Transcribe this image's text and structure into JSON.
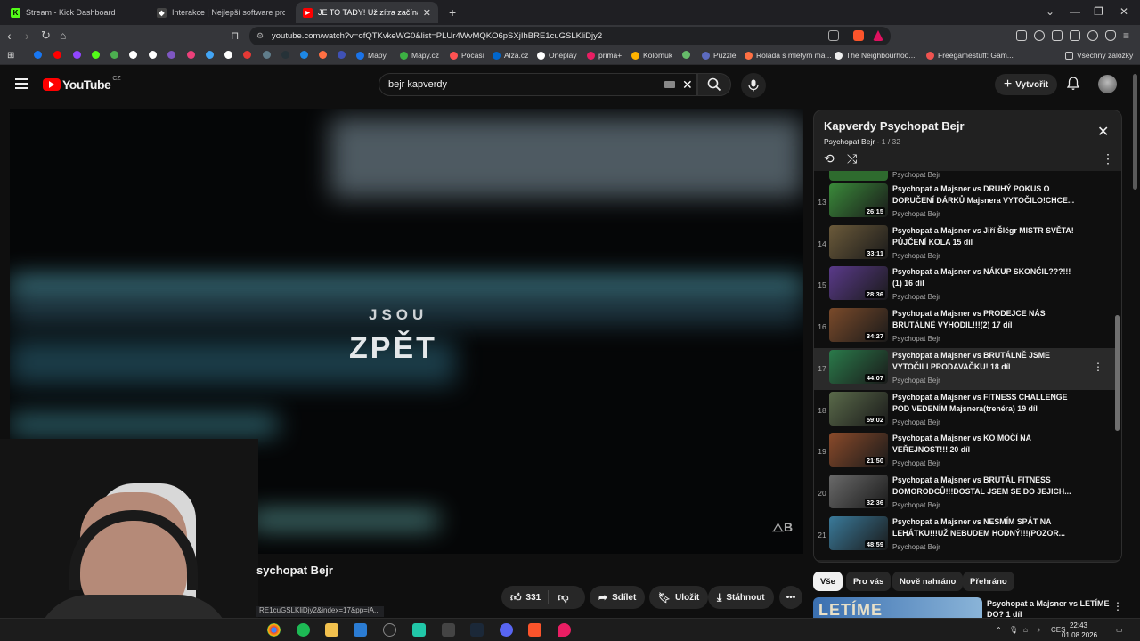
{
  "browser": {
    "tabs": [
      {
        "title": "Stream - Kick Dashboard",
        "favicon_color": "#53fc18",
        "favicon_text": "K"
      },
      {
        "title": "Interakce | Nejlepší software pro vyle",
        "favicon_color": "#cccccc",
        "favicon_text": ""
      },
      {
        "title": "JE TO TADY! Už zítra začíná show",
        "favicon_color": "#ff0000",
        "favicon_text": ""
      }
    ],
    "url": "youtube.com/watch?v=ofQTKvkeWG0&list=PLUr4WvMQKO6pSXjIhBRE1cuGSLKliDjy2",
    "bookmarks": [
      {
        "label": "Mapy",
        "color": "#1a73e8"
      },
      {
        "label": "Mapy.cz",
        "color": "#3cb043"
      },
      {
        "label": "Počasí",
        "color": "#ff5252"
      },
      {
        "label": "Alza.cz",
        "color": "#0066cc"
      },
      {
        "label": "Oneplay",
        "color": "#ffffff"
      },
      {
        "label": "prima+",
        "color": "#e91e63"
      },
      {
        "label": "Kolomuk",
        "color": "#ffb300"
      },
      {
        "label": "Puzzle",
        "color": "#5c6bc0"
      },
      {
        "label": "Roláda s mletým ma...",
        "color": "#ff7043"
      },
      {
        "label": "The Neighbourhoo...",
        "color": "#eeeeee"
      },
      {
        "label": "Freegamestuff: Gam...",
        "color": "#ef5350"
      }
    ],
    "bookmarks_all": "Všechny záložky"
  },
  "youtube": {
    "logo_text": "YouTube",
    "region": "CZ",
    "search_value": "bejr kapverdy",
    "create_label": "Vytvořit",
    "video": {
      "overlay_line1": "JSOU",
      "overlay_line2": "ZPĚT",
      "title_partial": "sychopat Bejr",
      "likes": "331",
      "share_label": "Sdílet",
      "save_label": "Uložit",
      "download_label": "Stáhnout",
      "status_url": "RE1cuGSLKliDjy2&index=17&pp=iA..."
    },
    "playlist": {
      "title": "Kapverdy Psychopat Bejr",
      "channel": "Psychopat Bejr",
      "position": "- 1 / 32",
      "partial_top_channel": "Psychopat Bejr",
      "items": [
        {
          "num": "13",
          "title": "Psychopat a Majsner vs DRUHÝ POKUS O DORUČENÍ DÁRKŮ Majsnera VYTOČILO!CHCE...",
          "channel": "Psychopat Bejr",
          "duration": "26:15",
          "thumb": "#3a8a3a"
        },
        {
          "num": "14",
          "title": "Psychopat a Majsner vs Jiří Šlégr MISTR SVĚTA! PŮJČENÍ KOLA 15 díl",
          "channel": "Psychopat Bejr",
          "duration": "33:11",
          "thumb": "#6b5a3a"
        },
        {
          "num": "15",
          "title": "Psychopat a Majsner vs NÁKUP SKONČIL???!!!(1) 16 díl",
          "channel": "Psychopat Bejr",
          "duration": "28:36",
          "thumb": "#5a3a8a"
        },
        {
          "num": "16",
          "title": "Psychopat a Majsner vs PRODEJCE NÁS BRUTÁLNĚ VYHODIL!!!(2) 17 díl",
          "channel": "Psychopat Bejr",
          "duration": "34:27",
          "thumb": "#7a4a2a"
        },
        {
          "num": "17",
          "title": "Psychopat a Majsner vs BRUTÁLNĚ JSME VYTOČILI PRODAVAČKU! 18 díl",
          "channel": "Psychopat Bejr",
          "duration": "44:07",
          "thumb": "#2a7a4a",
          "active": true
        },
        {
          "num": "18",
          "title": "Psychopat a Majsner vs FITNESS CHALLENGE POD VEDENÍM Majsnera(trenéra) 19 díl",
          "channel": "Psychopat Bejr",
          "duration": "59:02",
          "thumb": "#5a6a4a"
        },
        {
          "num": "19",
          "title": "Psychopat a Majsner vs KO MOČÍ NA VEŘEJNOST!!! 20 díl",
          "channel": "Psychopat Bejr",
          "duration": "21:50",
          "thumb": "#8a4a2a"
        },
        {
          "num": "20",
          "title": "Psychopat a Majsner vs BRUTÁL FITNESS DOMORODCŮ!!!DOSTAL JSEM SE DO JEJICH...",
          "channel": "Psychopat Bejr",
          "duration": "32:36",
          "thumb": "#6a6a6a"
        },
        {
          "num": "21",
          "title": "Psychopat a Majsner vs NESMÍM SPÁT NA LEHÁTKU!!!UŽ NEBUDEM HODNÝ!!!(POZOR...",
          "channel": "Psychopat Bejr",
          "duration": "48:59",
          "thumb": "#3a7a9a"
        }
      ]
    },
    "chips": [
      "Vše",
      "Pro vás",
      "Nově nahráno",
      "Přehráno"
    ],
    "next_video": {
      "title": "Psychopat a Majsner vs LETÍME DO? 1 díl",
      "thumb_text": "LETÍME"
    }
  },
  "taskbar": {
    "tray_lang": "CES",
    "time": "22:43",
    "date": "01.08.2026"
  },
  "colors": {
    "yt_red": "#ff0000",
    "bg": "#0f0f0f",
    "panel": "#212121"
  }
}
